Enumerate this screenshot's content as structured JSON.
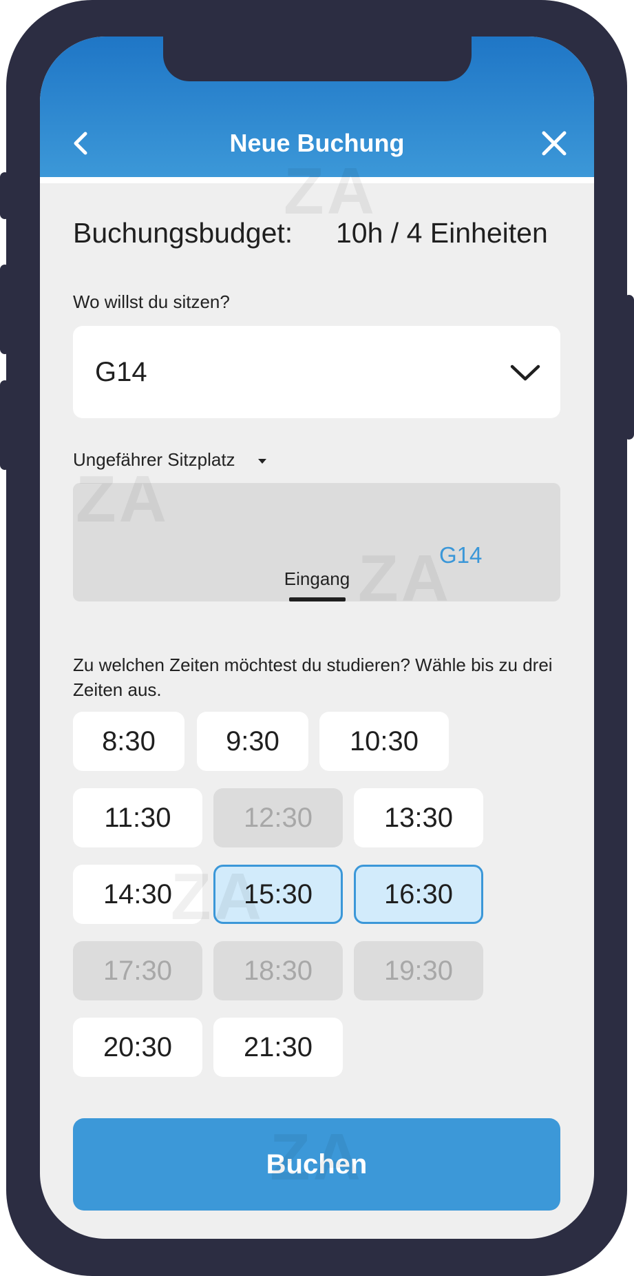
{
  "header": {
    "title": "Neue Buchung",
    "back_icon": "chevron-left-icon",
    "close_icon": "close-icon"
  },
  "budget": {
    "label": "Buchungsbudget:",
    "value": "10h / 4 Einheiten"
  },
  "location": {
    "question": "Wo willst du sitzen?",
    "selected": "G14",
    "dropdown_icon": "chevron-down-icon"
  },
  "seat_map": {
    "label": "Ungefährer Sitzplatz",
    "seat_label": "G14",
    "entrance_label": "Eingang"
  },
  "watermark": "ZA",
  "times": {
    "question": "Zu welchen Zeiten möchtest du studieren? Wähle bis zu drei Zeiten aus.",
    "slots": [
      {
        "label": "8:30",
        "state": "available"
      },
      {
        "label": "9:30",
        "state": "available"
      },
      {
        "label": "10:30",
        "state": "available"
      },
      {
        "label": "11:30",
        "state": "available"
      },
      {
        "label": "12:30",
        "state": "disabled"
      },
      {
        "label": "13:30",
        "state": "available"
      },
      {
        "label": "14:30",
        "state": "available"
      },
      {
        "label": "15:30",
        "state": "selected"
      },
      {
        "label": "16:30",
        "state": "selected"
      },
      {
        "label": "17:30",
        "state": "disabled"
      },
      {
        "label": "18:30",
        "state": "disabled"
      },
      {
        "label": "19:30",
        "state": "disabled"
      },
      {
        "label": "20:30",
        "state": "available"
      },
      {
        "label": "21:30",
        "state": "available"
      }
    ]
  },
  "actions": {
    "book_label": "Buchen"
  },
  "colors": {
    "accent": "#3c98d8",
    "header_top": "#1f76c6",
    "frame": "#2c2d42",
    "selected_fill": "#d2ebfb",
    "disabled_fill": "#dcdcdc"
  }
}
